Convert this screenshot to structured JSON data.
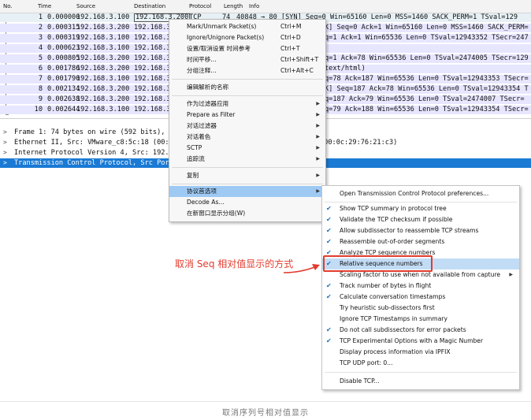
{
  "packet_list": {
    "columns": [
      "No.",
      "Time",
      "Source",
      "Destination",
      "Protocol",
      "Length",
      "Info"
    ],
    "rows": [
      {
        "no": "1",
        "time": "0.000000",
        "src": "192.168.3.100",
        "dst": "192.168.3.200",
        "proto": "TCP",
        "len": "74",
        "info": "40848 → 80 [SYN] Seq=0 Win=65160 Len=0 MSS=1460 SACK_PERM=1 TSval=129"
      },
      {
        "no": "2",
        "time": "0.000315",
        "src": "192.168.3.200",
        "dst": "192.168.3",
        "proto": "",
        "len": "",
        "info": "K] Seq=0 Ack=1 Win=65160 Len=0 MSS=1460 SACK_PERM="
      },
      {
        "no": "3",
        "time": "0.000319",
        "src": "192.168.3.100",
        "dst": "192.168.3",
        "proto": "",
        "len": "",
        "info": "q=1 Ack=1 Win=65536 Len=0 TSval=12943352 TSecr=247"
      },
      {
        "no": "4",
        "time": "0.000623",
        "src": "192.168.3.100",
        "dst": "192.168.3",
        "proto": "",
        "len": "",
        "info": ""
      },
      {
        "no": "5",
        "time": "0.000805",
        "src": "192.168.3.200",
        "dst": "192.168.3",
        "proto": "",
        "len": "",
        "info": "q=1 Ack=78 Win=65536 Len=0 TSval=2474005 TSecr=129"
      },
      {
        "no": "6",
        "time": "0.001786",
        "src": "192.168.3.200",
        "dst": "192.168.3",
        "proto": "",
        "len": "",
        "info": "text/html)"
      },
      {
        "no": "7",
        "time": "0.001790",
        "src": "192.168.3.100",
        "dst": "192.168.3",
        "proto": "",
        "len": "",
        "info": "q=78 Ack=187 Win=65536 Len=0 TSval=12943353 TSecr="
      },
      {
        "no": "8",
        "time": "0.002134",
        "src": "192.168.3.200",
        "dst": "192.168.3",
        "proto": "",
        "len": "",
        "info": "K] Seq=187 Ack=78 Win=65536 Len=0 TSval=12943354 T"
      },
      {
        "no": "9",
        "time": "0.002638",
        "src": "192.168.3.200",
        "dst": "192.168.3",
        "proto": "",
        "len": "",
        "info": "q=187 Ack=79 Win=65536 Len=0 TSval=2474007 TSecr="
      },
      {
        "no": "10",
        "time": "0.002644",
        "src": "192.168.3.100",
        "dst": "192.168.3",
        "proto": "",
        "len": "",
        "info": "q=79 Ack=188 Win=65536 Len=0 TSval=12943354 TSecr="
      }
    ]
  },
  "details": {
    "items": [
      {
        "label": "Frame 1: 74 bytes on wire (592 bits),"
      },
      {
        "label": "Ethernet II, Src: VMware_c8:5c:18 (00:"
      },
      {
        "label": "Internet Protocol Version 4, Src: 192."
      },
      {
        "label": "Transmission Control Protocol, Src Por"
      }
    ],
    "ethernet_overflow": "(00:0c:29:76:21:c3)",
    "arrow_glyph": ">"
  },
  "context_menu": {
    "items": [
      {
        "label": "Mark/Unmark Packet(s)",
        "shortcut": "Ctrl+M"
      },
      {
        "label": "Ignore/Unignore Packet(s)",
        "shortcut": "Ctrl+D"
      },
      {
        "label": "设置/取消设置 时间参考",
        "shortcut": "Ctrl+T"
      },
      {
        "label": "时间平移...",
        "shortcut": "Ctrl+Shift+T"
      },
      {
        "label": "分组注释...",
        "shortcut": "Ctrl+Alt+C"
      },
      {
        "label": "编辑解析的名称",
        "shortcut": ""
      },
      {
        "label": "作为过滤器应用",
        "shortcut": ""
      },
      {
        "label": "Prepare as Filter",
        "shortcut": ""
      },
      {
        "label": "对话过滤器",
        "shortcut": ""
      },
      {
        "label": "对话着色",
        "shortcut": ""
      },
      {
        "label": "SCTP",
        "shortcut": ""
      },
      {
        "label": "追踪流",
        "shortcut": ""
      },
      {
        "label": "复制",
        "shortcut": ""
      },
      {
        "label": "协议首选项",
        "shortcut": ""
      },
      {
        "label": "Decode As...",
        "shortcut": ""
      },
      {
        "label": "在新窗口显示分组(W)",
        "shortcut": ""
      }
    ],
    "submenu_arrow": "▶"
  },
  "submenu": {
    "header": "Open Transmission Control Protocol preferences...",
    "items": [
      {
        "label": "Show TCP summary in protocol tree",
        "checked": true
      },
      {
        "label": "Validate the TCP checksum if possible",
        "checked": true
      },
      {
        "label": "Allow subdissector to reassemble TCP streams",
        "checked": true
      },
      {
        "label": "Reassemble out-of-order segments",
        "checked": true
      },
      {
        "label": "Analyze TCP sequence numbers",
        "checked": true
      },
      {
        "label": "Relative sequence numbers",
        "checked": true
      },
      {
        "label": "Scaling factor to use when not available from capture",
        "checked": false
      },
      {
        "label": "Track number of bytes in flight",
        "checked": true
      },
      {
        "label": "Calculate conversation timestamps",
        "checked": true
      },
      {
        "label": "Try heuristic sub-dissectors first",
        "checked": false
      },
      {
        "label": "Ignore TCP Timestamps in summary",
        "checked": false
      },
      {
        "label": "Do not call subdissectors for error packets",
        "checked": true
      },
      {
        "label": "TCP Experimental Options with a Magic Number",
        "checked": true
      },
      {
        "label": "Display process information via IPFIX",
        "checked": false
      },
      {
        "label": "TCP UDP port: 0...",
        "checked": false
      }
    ],
    "footer": "Disable TCP...",
    "check_glyph": "✔"
  },
  "annotation": {
    "text": "取消 Seq 相对值显示的方式",
    "color": "#e23b2e"
  },
  "caption": "取消序列号相对值显示",
  "colors": {
    "selection_blue": "#1a7ad4",
    "menu_highlight": "#9ec9f3",
    "row_highlight": "#e7e6ff"
  }
}
